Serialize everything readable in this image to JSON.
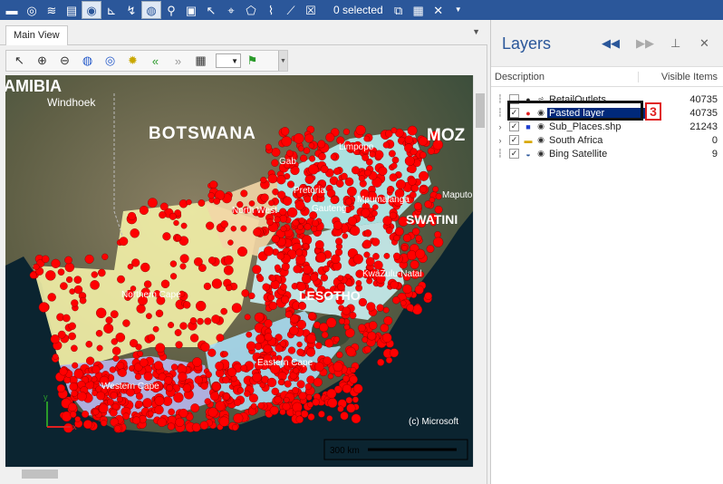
{
  "toolbar": {
    "selected_text": "0 selected",
    "icons": [
      "folder-icon",
      "globe-settings-icon",
      "layers-icon",
      "map-icon",
      "layer-style-icon",
      "chart-icon",
      "route-icon",
      "world-icon",
      "pin-icon",
      "frame-icon",
      "select-arrow-icon",
      "node-select-icon",
      "polygon-select-icon",
      "polyline-select-icon",
      "line-select-icon",
      "clear-selection-icon",
      "selection-properties-icon",
      "table-icon",
      "excel-icon",
      "dropdown-icon"
    ]
  },
  "main_view": {
    "tab_label": "Main View",
    "copyright": "(c) Microsoft",
    "scalebar_label": "300 km",
    "map_labels": {
      "country_1": "AMIBIA",
      "city_1": "Windhoek",
      "country_2": "BOTSWANA",
      "country_3": "MOZ",
      "region_1": "Limpopo",
      "region_2": "Gauteng",
      "region_3": "North West",
      "region_4": "Mpumalanga",
      "country_4": "SWATINI",
      "region_5": "KwaZulu-Natal",
      "country_5": "LESOTHO",
      "region_6": "Northern Cape",
      "region_7": "Western Cape",
      "region_8": "Eastern Cape",
      "city_2": "Gab",
      "city_3": "Pretoria",
      "city_4": "Maputo"
    },
    "axis_x": "x",
    "axis_y": "y"
  },
  "layers": {
    "title": "Layers",
    "col_description": "Description",
    "col_visible": "Visible Items",
    "rows": [
      {
        "name": "RetailOutlets",
        "visible": "40735"
      },
      {
        "name": "Pasted layer",
        "visible": "40735"
      },
      {
        "name": "Sub_Places.shp",
        "visible": "21243"
      },
      {
        "name": "South Africa",
        "visible": "0"
      },
      {
        "name": "Bing Satellite",
        "visible": "9"
      }
    ],
    "annotation": "3"
  },
  "colors": {
    "accent": "#2b579a",
    "points": "#ff0000",
    "selection": "#00297a"
  }
}
